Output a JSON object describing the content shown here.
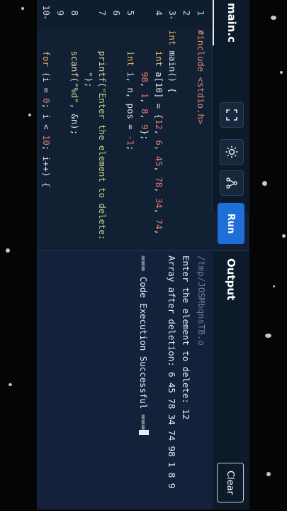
{
  "editor": {
    "file_tab": "main.c",
    "run_label": "Run",
    "tools": [
      {
        "icon": "fullscreen-icon"
      },
      {
        "icon": "theme-sun-icon"
      },
      {
        "icon": "share-icon"
      }
    ],
    "lines": [
      {
        "n": "1",
        "fold": "",
        "parts": [
          {
            "c": "pp",
            "t": "#include <stdio.h>"
          }
        ]
      },
      {
        "n": "2",
        "fold": "",
        "parts": []
      },
      {
        "n": "3",
        "fold": "▾",
        "parts": [
          {
            "c": "kw",
            "t": "int"
          },
          {
            "c": "",
            "t": " main() {"
          }
        ]
      },
      {
        "n": "4",
        "fold": "",
        "parts": [
          {
            "c": "",
            "t": "    "
          },
          {
            "c": "kw",
            "t": "int"
          },
          {
            "c": "",
            "t": " a[10] = {"
          },
          {
            "c": "num",
            "t": "12"
          },
          {
            "c": "",
            "t": ", "
          },
          {
            "c": "num",
            "t": "6"
          },
          {
            "c": "",
            "t": ", "
          },
          {
            "c": "num",
            "t": "45"
          },
          {
            "c": "",
            "t": ", "
          },
          {
            "c": "num",
            "t": "78"
          },
          {
            "c": "",
            "t": ", "
          },
          {
            "c": "num",
            "t": "34"
          },
          {
            "c": "",
            "t": ", "
          },
          {
            "c": "num",
            "t": "74"
          },
          {
            "c": "",
            "t": ","
          }
        ]
      },
      {
        "n": "",
        "fold": "",
        "parts": [
          {
            "c": "",
            "t": "        "
          },
          {
            "c": "num",
            "t": "98"
          },
          {
            "c": "",
            "t": ", "
          },
          {
            "c": "num",
            "t": "1"
          },
          {
            "c": "",
            "t": ", "
          },
          {
            "c": "num",
            "t": "8"
          },
          {
            "c": "",
            "t": ", "
          },
          {
            "c": "num",
            "t": "9"
          },
          {
            "c": "",
            "t": "};"
          }
        ]
      },
      {
        "n": "5",
        "fold": "",
        "parts": [
          {
            "c": "",
            "t": "    "
          },
          {
            "c": "kw",
            "t": "int"
          },
          {
            "c": "",
            "t": " i, n, pos = "
          },
          {
            "c": "num",
            "t": "-1"
          },
          {
            "c": "",
            "t": ";"
          }
        ]
      },
      {
        "n": "6",
        "fold": "",
        "parts": []
      },
      {
        "n": "7",
        "fold": "",
        "parts": [
          {
            "c": "",
            "t": "    "
          },
          {
            "c": "fn",
            "t": "printf"
          },
          {
            "c": "",
            "t": "("
          },
          {
            "c": "str",
            "t": "\"Enter the element to delete: "
          }
        ]
      },
      {
        "n": "",
        "fold": "",
        "parts": [
          {
            "c": "str",
            "t": "        \""
          },
          {
            "c": "",
            "t": ");"
          }
        ]
      },
      {
        "n": "8",
        "fold": "",
        "parts": [
          {
            "c": "",
            "t": "    "
          },
          {
            "c": "fn",
            "t": "scanf"
          },
          {
            "c": "",
            "t": "("
          },
          {
            "c": "str",
            "t": "\"%d\""
          },
          {
            "c": "",
            "t": ", &n);"
          }
        ]
      },
      {
        "n": "9",
        "fold": "",
        "parts": []
      },
      {
        "n": "10",
        "fold": "▾",
        "parts": [
          {
            "c": "",
            "t": "    "
          },
          {
            "c": "kw",
            "t": "for"
          },
          {
            "c": "",
            "t": " (i = "
          },
          {
            "c": "num",
            "t": "0"
          },
          {
            "c": "",
            "t": "; i < "
          },
          {
            "c": "num",
            "t": "10"
          },
          {
            "c": "",
            "t": "; i++) {"
          }
        ]
      }
    ]
  },
  "output": {
    "title": "Output",
    "clear_label": "Clear",
    "path": "/tmp/JOSMbqnsTB.o",
    "lines": [
      "Enter the element to delete: 12",
      "Array after deletion: 6 45 78 34 74 98 1 8 9",
      "",
      "=== Code Execution Successful ==="
    ]
  }
}
